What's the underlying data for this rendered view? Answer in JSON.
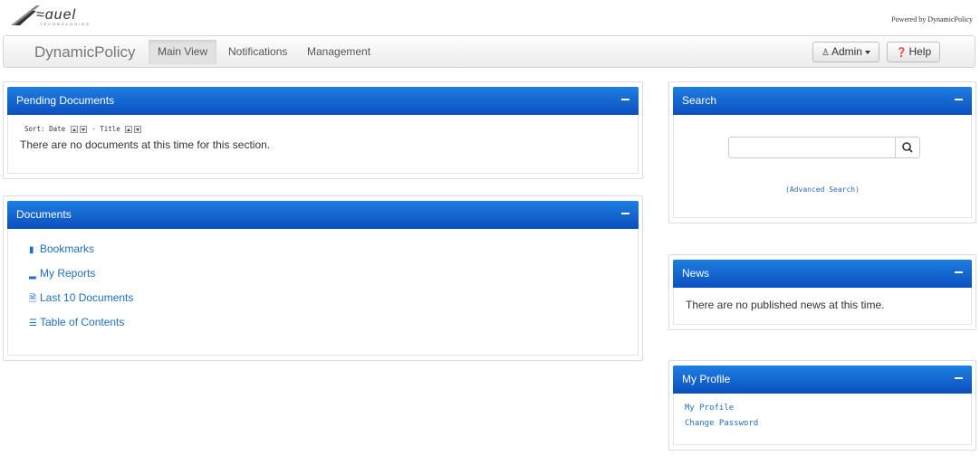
{
  "header": {
    "logo_alt": "ZEQUEL TECHNOLOGIES",
    "powered_by": "Powered by DynamicPolicy"
  },
  "navbar": {
    "brand": "DynamicPolicy",
    "tabs": [
      {
        "label": "Main View",
        "active": true
      },
      {
        "label": "Notifications",
        "active": false
      },
      {
        "label": "Management",
        "active": false
      }
    ],
    "user_menu": "Admin",
    "help": "Help"
  },
  "pending": {
    "title": "Pending Documents",
    "sort_label": "Sort: Date",
    "sort_sep": "- Title",
    "message": "There are no documents at this time for this section."
  },
  "documents": {
    "title": "Documents",
    "links": [
      {
        "label": "Bookmarks",
        "icon": "bookmark-icon"
      },
      {
        "label": "My Reports",
        "icon": "signal-icon"
      },
      {
        "label": "Last 10 Documents",
        "icon": "file-icon"
      },
      {
        "label": "Table of Contents",
        "icon": "list-icon"
      }
    ]
  },
  "search": {
    "title": "Search",
    "placeholder": "",
    "advanced": "(Advanced Search)"
  },
  "news": {
    "title": "News",
    "message": "There are no published news at this time."
  },
  "profile": {
    "title": "My Profile",
    "links": [
      "My Profile",
      "Change Password"
    ]
  },
  "colors": {
    "panel_header_top": "#1f7fe0",
    "panel_header_bottom": "#0a4fc0",
    "link": "#1f6fc0"
  }
}
